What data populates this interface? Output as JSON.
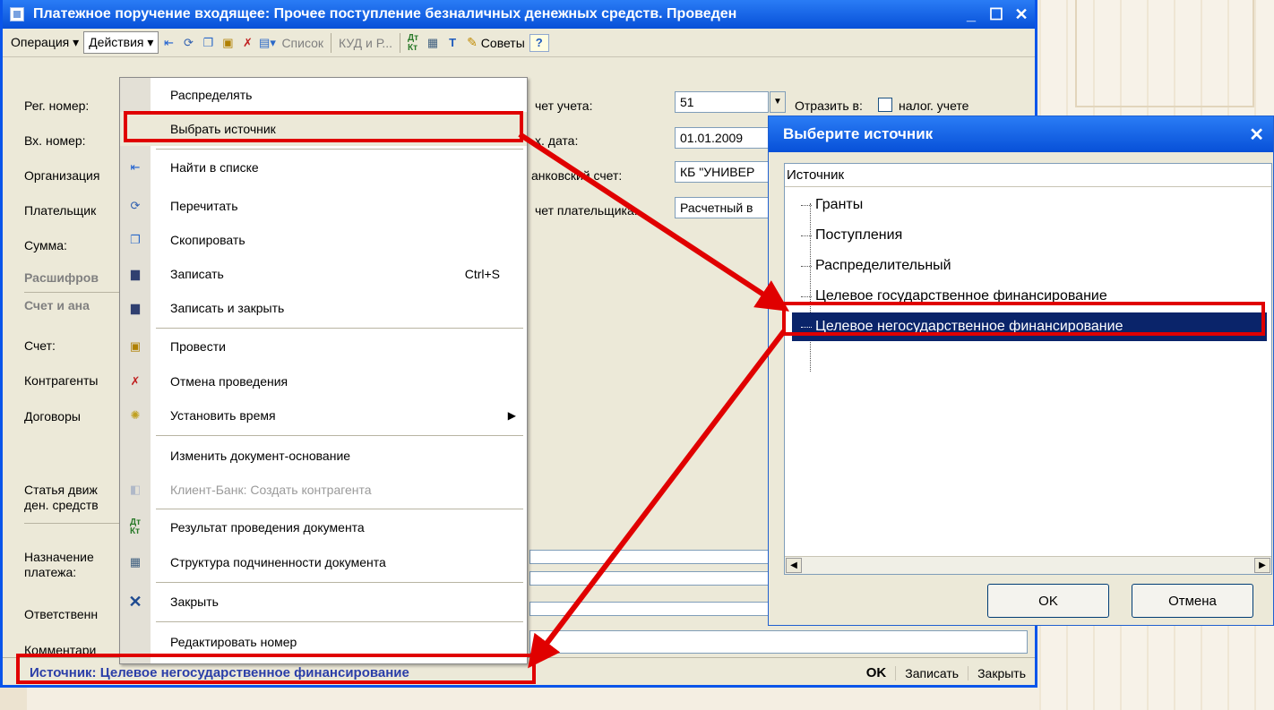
{
  "window": {
    "title": "Платежное поручение входящее: Прочее поступление безналичных денежных средств. Проведен",
    "min": "_",
    "max": "☐",
    "close": "✕"
  },
  "toolbar": {
    "operation": "Операция ▾",
    "actions": "Действия ▾",
    "list": "Список",
    "kud": "КУД и Р...",
    "tips": "Советы",
    "help": "?"
  },
  "form": {
    "reg_number_label": "Рег. номер:",
    "in_number_label": "Вх. номер:",
    "organization_label": "Организация",
    "payer_label": "Плательщик",
    "sum_label": "Сумма:",
    "decode_section": "Расшифров",
    "account_section": "Счет и ана",
    "account_label": "Счет:",
    "contractors_label": "Контрагенты",
    "contracts_label": "Договоры",
    "cashflow_label_1": "Статья движ",
    "cashflow_label_2": "ден. средств",
    "purpose_label_1": "Назначение",
    "purpose_label_2": "платежа:",
    "responsible_label": "Ответственн",
    "comment_label": "Комментари",
    "account_accounting_label": "чет учета:",
    "account_accounting_value": "51",
    "reflect_label": "Отразить в:",
    "tax_accounting_label": "налог. учете",
    "in_date_label": "х. дата:",
    "in_date_value": "01.01.2009",
    "bank_account_label": "анковский счет:",
    "bank_account_value": "КБ \"УНИВЕР",
    "payer_account_label": "чет плательщика:",
    "payer_account_value": "Расчетный в"
  },
  "menu": {
    "items": [
      {
        "label": "Распределять"
      },
      {
        "label": "Выбрать источник"
      },
      {
        "label": "Найти в списке"
      },
      {
        "label": "Перечитать"
      },
      {
        "label": "Скопировать"
      },
      {
        "label": "Записать",
        "shortcut": "Ctrl+S"
      },
      {
        "label": "Записать и закрыть"
      },
      {
        "label": "Провести"
      },
      {
        "label": "Отмена проведения"
      },
      {
        "label": "Установить время",
        "arrow": "▶"
      },
      {
        "label": "Изменить документ-основание"
      },
      {
        "label": "Клиент-Банк: Создать контрагента"
      },
      {
        "label": "Результат проведения документа"
      },
      {
        "label": "Структура подчиненности документа"
      },
      {
        "label": "Закрыть"
      },
      {
        "label": "Редактировать номер"
      }
    ]
  },
  "dialog": {
    "title": "Выберите источник",
    "close": "✕",
    "column_header": "Источник",
    "items": [
      "Гранты",
      "Поступления",
      "Распределительный",
      "Целевое государственное финансирование",
      "Целевое негосударственное финансирование"
    ],
    "ok": "OK",
    "cancel": "Отмена"
  },
  "status": {
    "text": "Источник: Целевое негосударственное финансирование",
    "ok": "OK",
    "save": "Записать",
    "close": "Закрыть"
  },
  "colors": {
    "titlebar": "#0750d8",
    "highlight_red": "#e00000",
    "selection": "#0a246a",
    "status_text": "#2a3ea8"
  }
}
